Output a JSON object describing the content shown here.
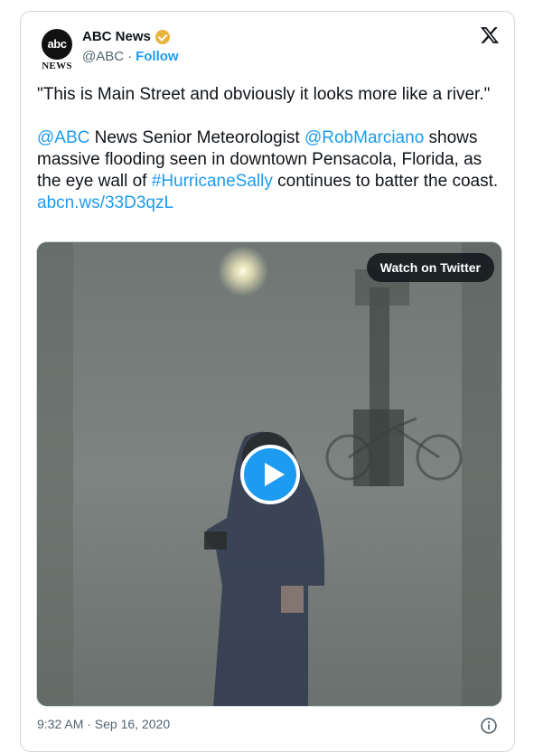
{
  "author": {
    "display_name": "ABC News",
    "logo_text": "abc",
    "logo_subtext": "NEWS",
    "handle": "@ABC",
    "separator": "·",
    "follow_label": "Follow",
    "verified_color": "#e8b339"
  },
  "tweet": {
    "quote": "\"This is Main Street and obviously it looks more like a river.\"",
    "mention_abc": "@ABC",
    "text_1": " News Senior Meteorologist ",
    "mention_rob": "@RobMarciano",
    "text_2": " shows massive flooding seen in downtown Pensacola, Florida, as the eye wall of ",
    "hashtag": "#HurricaneSally",
    "text_3": " continues to batter the coast. ",
    "link": "abcn.ws/33D3qzL"
  },
  "media": {
    "watch_label": "Watch on Twitter",
    "play_icon": "play-icon"
  },
  "footer": {
    "timestamp": "9:32 AM · Sep 16, 2020",
    "info_icon": "info-icon"
  },
  "colors": {
    "link": "#1d9bf0",
    "secondary_text": "#536471",
    "border": "#cfd9de"
  }
}
